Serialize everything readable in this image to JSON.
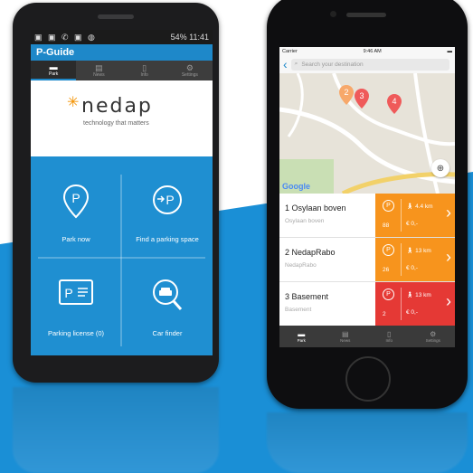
{
  "colors": {
    "brand_blue": "#1f8fd1",
    "orange": "#f7941d",
    "red": "#e53935"
  },
  "android": {
    "status_left": "▣ ▣ ✆ ▣ ◍",
    "status_right": "54% 11:41",
    "app_title": "P-Guide",
    "tabs": [
      {
        "label": "Park",
        "icon": "car-icon"
      },
      {
        "label": "News",
        "icon": "news-icon"
      },
      {
        "label": "Info",
        "icon": "info-icon"
      },
      {
        "label": "Settings",
        "icon": "gear-icon"
      }
    ],
    "logo_text": "nedap",
    "logo_tagline": "technology that matters",
    "menu": [
      {
        "label": "Park now",
        "icon": "parking-pin-icon"
      },
      {
        "label": "Find a parking space",
        "icon": "arrow-parking-icon"
      },
      {
        "label": "Parking license (0)",
        "icon": "license-card-icon"
      },
      {
        "label": "Car finder",
        "icon": "car-search-icon"
      }
    ]
  },
  "iphone": {
    "carrier": "Carrier",
    "time": "9:46 AM",
    "search_placeholder": "Search your destination",
    "map_markers": [
      "2",
      "3",
      "4"
    ],
    "google_label": "Google",
    "garages": [
      {
        "name": "1 Osylaan boven",
        "sub": "Osylaan boven",
        "count": "88",
        "distance": "4.4 km",
        "cost": "€ 0,-",
        "status": "orange"
      },
      {
        "name": "2 NedapRabo",
        "sub": "NedapRabo",
        "count": "26",
        "distance": "13 km",
        "cost": "€ 0,-",
        "status": "orange"
      },
      {
        "name": "3 Basement",
        "sub": "Basement",
        "count": "2",
        "distance": "13 km",
        "cost": "€ 0,-",
        "status": "red"
      }
    ],
    "tabs": [
      {
        "label": "Park",
        "icon": "car-icon"
      },
      {
        "label": "News",
        "icon": "news-icon"
      },
      {
        "label": "Info",
        "icon": "info-icon"
      },
      {
        "label": "Settings",
        "icon": "gear-icon"
      }
    ]
  }
}
